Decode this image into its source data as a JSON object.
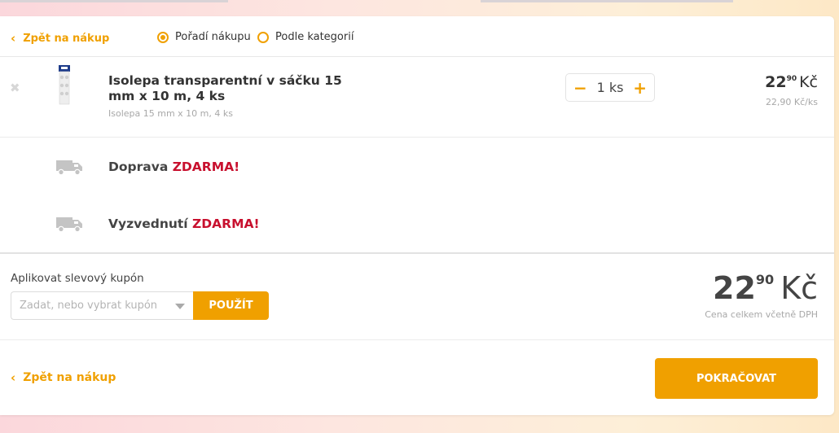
{
  "header": {
    "back_label": "Zpět na nákup",
    "sort_options": [
      {
        "label": "Pořadí nákupu",
        "selected": true
      },
      {
        "label": "Podle kategorií",
        "selected": false
      }
    ]
  },
  "cart": {
    "items": [
      {
        "name": "Isolepa transparentní v sáčku 15 mm x 10 m, 4 ks",
        "description": "Isolepa 15 mm x 10 m, 4 ks",
        "quantity": "1 ks",
        "price_int": "22",
        "price_dec": "90",
        "currency": "Kč",
        "unit_price": "22,90 Kč/ks",
        "icons": {
          "remove": "close-icon",
          "minus": "minus-icon",
          "plus": "plus-icon"
        }
      }
    ]
  },
  "shipping": [
    {
      "label": "Doprava",
      "free": "ZDARMA!",
      "icon": "truck-icon"
    },
    {
      "label": "Vyzvednutí",
      "free": "ZDARMA!",
      "icon": "truck-icon"
    }
  ],
  "coupon": {
    "label": "Aplikovat slevový kupón",
    "placeholder": "Zadat, nebo vybrat kupón",
    "value": "",
    "apply_label": "POUŽÍT"
  },
  "total": {
    "int": "22",
    "dec": "90",
    "currency": "Kč",
    "note": "Cena celkem včetně DPH"
  },
  "footer": {
    "back_label": "Zpět na nákup",
    "continue_label": "POKRAČOVAT"
  },
  "colors": {
    "accent": "#f0a000",
    "free_red": "#c8102e",
    "text": "#333333",
    "muted": "#a8a8a8"
  }
}
